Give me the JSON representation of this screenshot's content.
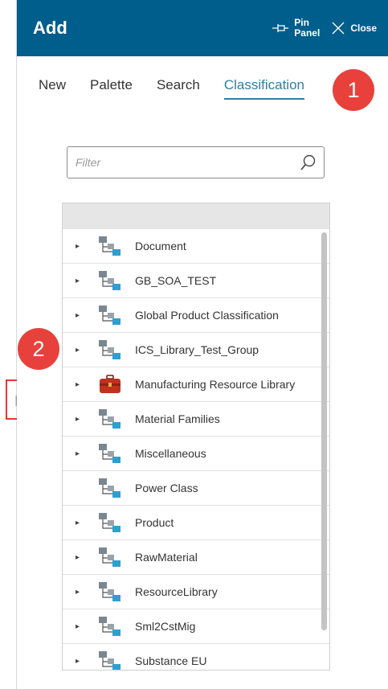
{
  "header": {
    "title": "Add",
    "pin_label_1": "Pin",
    "pin_label_2": "Panel",
    "close_label": "Close"
  },
  "tabs": [
    {
      "label": "New",
      "active": false
    },
    {
      "label": "Palette",
      "active": false
    },
    {
      "label": "Search",
      "active": false
    },
    {
      "label": "Classification",
      "active": true
    }
  ],
  "annotations": {
    "badge_1": "1",
    "badge_2": "2"
  },
  "filter": {
    "placeholder": "Filter",
    "value": ""
  },
  "tree": {
    "items": [
      {
        "label": "Document",
        "expandable": true,
        "icon": "classification-hierarchy-icon"
      },
      {
        "label": "GB_SOA_TEST",
        "expandable": true,
        "icon": "classification-hierarchy-icon"
      },
      {
        "label": "Global Product Classification",
        "expandable": true,
        "icon": "classification-hierarchy-icon"
      },
      {
        "label": "ICS_Library_Test_Group",
        "expandable": true,
        "icon": "classification-hierarchy-icon"
      },
      {
        "label": "Manufacturing Resource Library",
        "expandable": true,
        "icon": "toolbox-icon"
      },
      {
        "label": "Material Families",
        "expandable": true,
        "icon": "classification-hierarchy-icon"
      },
      {
        "label": "Miscellaneous",
        "expandable": true,
        "icon": "classification-hierarchy-icon"
      },
      {
        "label": "Power Class",
        "expandable": false,
        "icon": "classification-hierarchy-icon"
      },
      {
        "label": "Product",
        "expandable": true,
        "icon": "classification-hierarchy-icon"
      },
      {
        "label": "RawMaterial",
        "expandable": true,
        "icon": "classification-hierarchy-icon"
      },
      {
        "label": "ResourceLibrary",
        "expandable": true,
        "icon": "classification-hierarchy-icon"
      },
      {
        "label": "Sml2CstMig",
        "expandable": true,
        "icon": "classification-hierarchy-icon"
      },
      {
        "label": "Substance EU",
        "expandable": true,
        "icon": "classification-hierarchy-icon"
      }
    ]
  },
  "handle": {
    "glyph": "||"
  },
  "colors": {
    "header_bg": "#005e8c",
    "accent": "#2f7ea6",
    "badge": "#e8413c"
  }
}
